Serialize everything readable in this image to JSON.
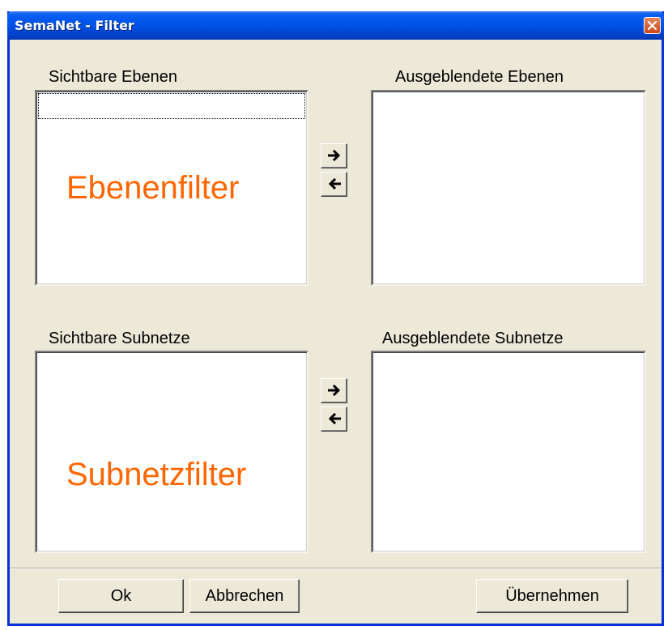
{
  "window": {
    "title": "SemaNet - Filter",
    "title_color": "#ffffff",
    "titlebar_color": "#0052e6",
    "close_icon": "close-icon"
  },
  "layers": {
    "visible_label": "Sichtbare Ebenen",
    "hidden_label": "Ausgeblendete Ebenen",
    "overlay": "Ebenenfilter",
    "move_right_icon": "arrow-right-icon",
    "move_left_icon": "arrow-left-icon"
  },
  "subnets": {
    "visible_label": "Sichtbare Subnetze",
    "hidden_label": "Ausgeblendete Subnetze",
    "overlay": "Subnetzfilter",
    "move_right_icon": "arrow-right-icon",
    "move_left_icon": "arrow-left-icon"
  },
  "footer": {
    "ok_label": "Ok",
    "cancel_label": "Abbrechen",
    "apply_label": "Übernehmen"
  },
  "colors": {
    "overlay_text": "#ff6600",
    "dialog_background": "#ece9d8"
  }
}
